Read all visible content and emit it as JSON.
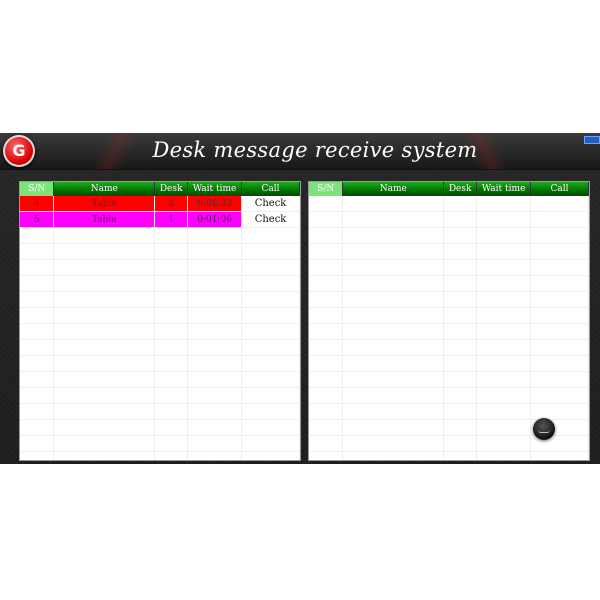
{
  "title": "Desk message receive system",
  "logo_text": "G",
  "columns": [
    "S/N",
    "Name",
    "Desk",
    "Wait time",
    "Call"
  ],
  "left_rows": [
    {
      "sn": "4",
      "name": "Table",
      "desk": "2",
      "wait": "0:08:33",
      "call": "Check",
      "color": "#ff0000"
    },
    {
      "sn": "5",
      "name": "Table",
      "desk": "1",
      "wait": "0:01:06",
      "call": "Check",
      "color": "#ff00ff"
    }
  ],
  "right_rows": [],
  "icons": {
    "logo": "app-logo-icon",
    "fab": "floating-action-button",
    "minimize": "minimize-icon"
  }
}
